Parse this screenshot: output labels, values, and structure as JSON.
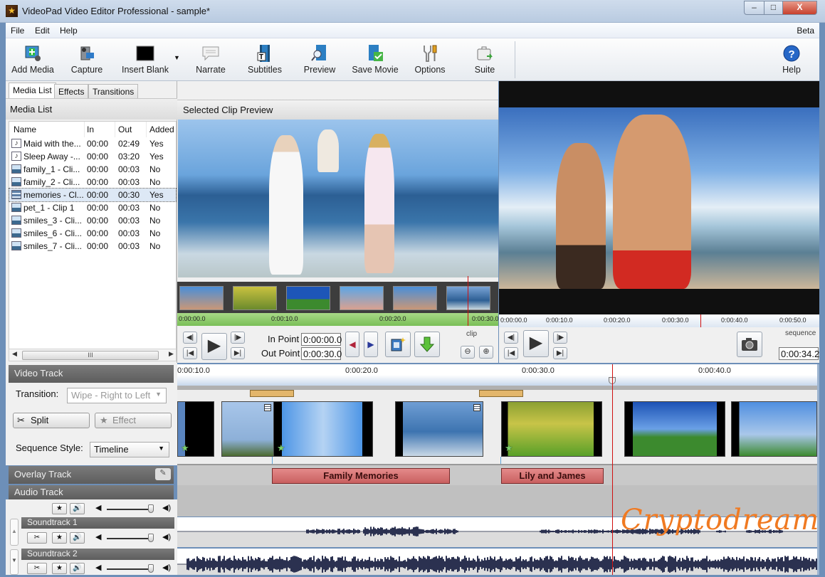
{
  "window": {
    "title": "VideoPad Video Editor Professional - sample*",
    "minimize": "–",
    "maximize": "□",
    "close": "X"
  },
  "menu": {
    "items": [
      {
        "label": "File"
      },
      {
        "label": "Edit"
      },
      {
        "label": "Help"
      }
    ],
    "beta": "Beta"
  },
  "toolbar": {
    "buttons": [
      {
        "label": "Add Media",
        "icon": "add-media-icon"
      },
      {
        "label": "Capture",
        "icon": "capture-icon"
      },
      {
        "label": "Insert Blank",
        "icon": "insert-blank-icon"
      },
      {
        "label": "Narrate",
        "icon": "narrate-icon"
      },
      {
        "label": "Subtitles",
        "icon": "subtitles-icon"
      },
      {
        "label": "Preview",
        "icon": "preview-icon"
      },
      {
        "label": "Save Movie",
        "icon": "save-movie-icon"
      },
      {
        "label": "Options",
        "icon": "options-icon"
      },
      {
        "label": "Suite",
        "icon": "suite-icon"
      }
    ],
    "help": "Help"
  },
  "left_panel": {
    "tabs": [
      {
        "label": "Media List"
      },
      {
        "label": "Effects"
      },
      {
        "label": "Transitions"
      }
    ],
    "title": "Media List",
    "columns": [
      "Name",
      "In",
      "Out",
      "Added"
    ],
    "rows": [
      {
        "type": "audio",
        "name": "Maid with the...",
        "in": "00:00",
        "out": "02:49",
        "added": "Yes"
      },
      {
        "type": "audio",
        "name": "Sleep Away -...",
        "in": "00:00",
        "out": "03:20",
        "added": "Yes"
      },
      {
        "type": "image",
        "name": "family_1 - Cli...",
        "in": "00:00",
        "out": "00:03",
        "added": "No"
      },
      {
        "type": "image",
        "name": "family_2 - Cli...",
        "in": "00:00",
        "out": "00:03",
        "added": "No"
      },
      {
        "type": "video",
        "name": "memories - Cl...",
        "in": "00:00",
        "out": "00:30",
        "added": "Yes",
        "selected": true
      },
      {
        "type": "image",
        "name": "pet_1 - Clip 1",
        "in": "00:00",
        "out": "00:03",
        "added": "No"
      },
      {
        "type": "image",
        "name": "smiles_3 - Cli...",
        "in": "00:00",
        "out": "00:03",
        "added": "No"
      },
      {
        "type": "image",
        "name": "smiles_6 - Cli...",
        "in": "00:00",
        "out": "00:03",
        "added": "No"
      },
      {
        "type": "image",
        "name": "smiles_7 - Cli...",
        "in": "00:00",
        "out": "00:03",
        "added": "No"
      }
    ]
  },
  "clip_preview": {
    "title": "Selected Clip Preview",
    "ruler": [
      "0:00:00.0",
      "0:00:10.0",
      "0:00:20.0",
      "0:00:30.0"
    ],
    "in_label": "In Point",
    "in_value": "0:00:00.0",
    "out_label": "Out Point",
    "out_value": "0:00:30.0",
    "tag": "clip"
  },
  "sequence_preview": {
    "ruler": [
      "0:00:00.0",
      "0:00:10.0",
      "0:00:20.0",
      "0:00:30.0",
      "0:00:40.0",
      "0:00:50.0"
    ],
    "tag": "sequence",
    "time": "0:00:34.2"
  },
  "video_track": {
    "title": "Video Track",
    "transition_label": "Transition:",
    "transition_value": "Wipe - Right to Left",
    "split": "Split",
    "effect": "Effect",
    "sequence_style_label": "Sequence Style:",
    "sequence_style_value": "Timeline"
  },
  "overlay_track": {
    "title": "Overlay Track",
    "clips": [
      {
        "label": "Family Memories"
      },
      {
        "label": "Lily and James"
      }
    ]
  },
  "audio_track": {
    "title": "Audio Track",
    "soundtracks": [
      {
        "label": "Soundtrack 1"
      },
      {
        "label": "Soundtrack 2"
      }
    ]
  },
  "timeline": {
    "ruler": [
      "0:00:10.0",
      "0:00:20.0",
      "0:00:30.0",
      "0:00:40.0"
    ],
    "playhead": "0:00:34.2"
  },
  "watermark": "Cryptodream"
}
